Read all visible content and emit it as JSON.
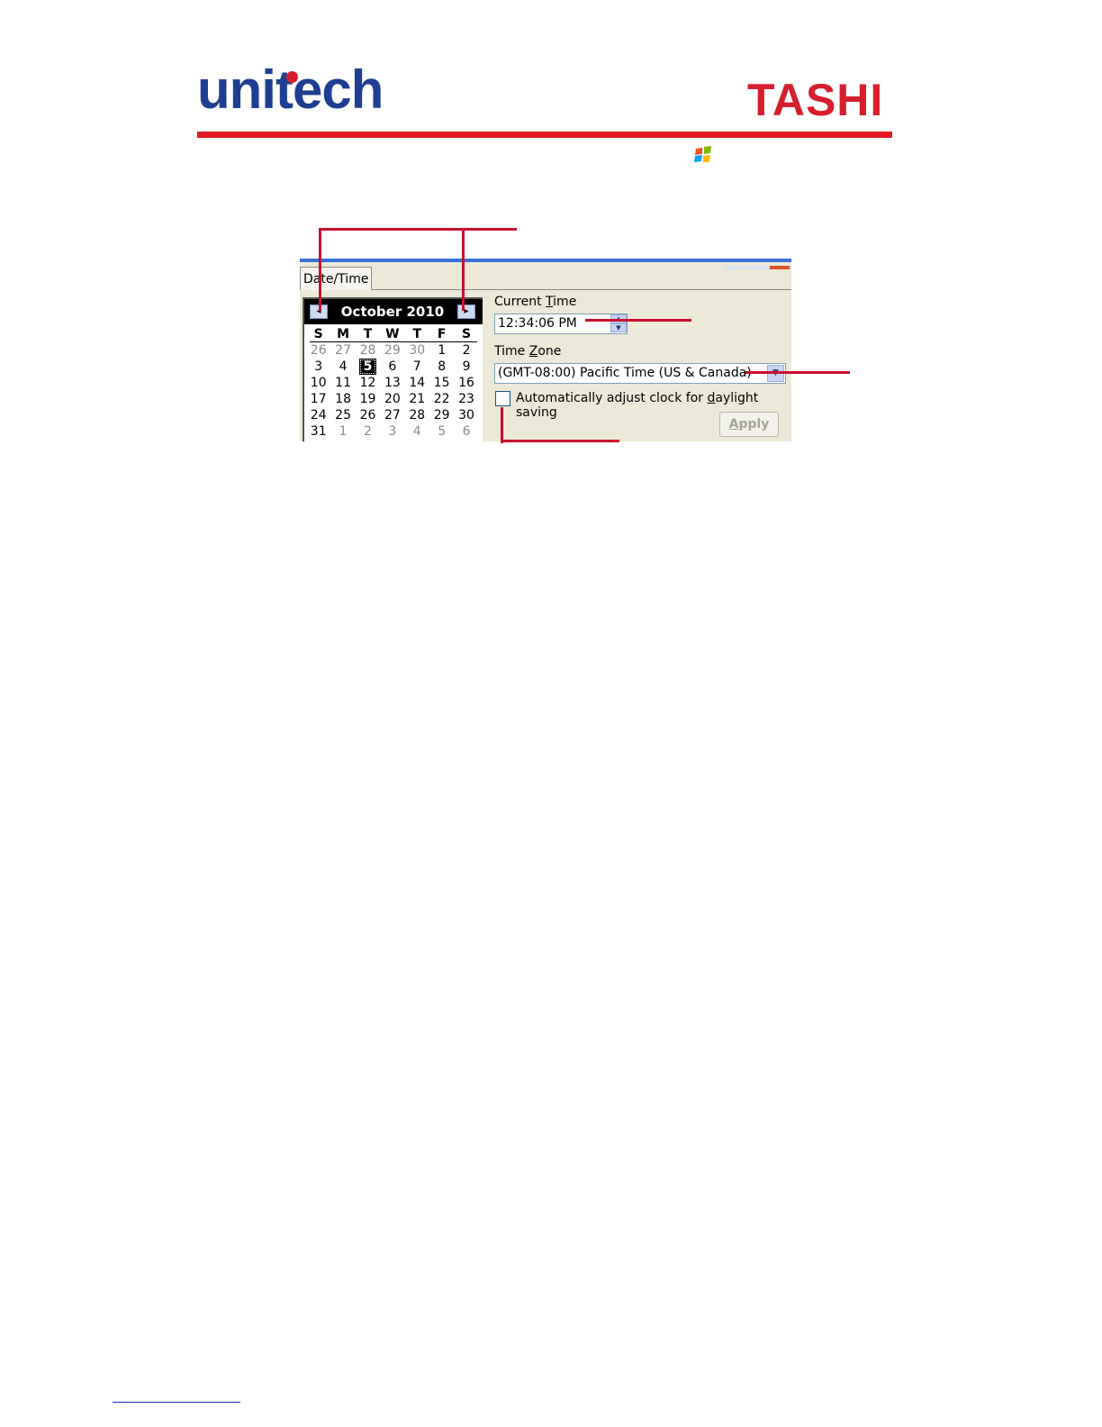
{
  "header": {
    "left_logo": "unitech",
    "right_logo": "TASHI",
    "logo_color_left": "#1e3f91",
    "logo_color_right": "#d51f2e",
    "rule_color": "#e21b23",
    "os_icon": "windows-flag-icon"
  },
  "dialog": {
    "tab_label": "Date/Time",
    "calendar": {
      "month_year": "October 2010",
      "prev_icon": "◂",
      "next_icon": "▸",
      "weekdays": [
        "S",
        "M",
        "T",
        "W",
        "T",
        "F",
        "S"
      ],
      "weeks": [
        [
          "26",
          "27",
          "28",
          "29",
          "30",
          "1",
          "2"
        ],
        [
          "3",
          "4",
          "5",
          "6",
          "7",
          "8",
          "9"
        ],
        [
          "10",
          "11",
          "12",
          "13",
          "14",
          "15",
          "16"
        ],
        [
          "17",
          "18",
          "19",
          "20",
          "21",
          "22",
          "23"
        ],
        [
          "24",
          "25",
          "26",
          "27",
          "28",
          "29",
          "30"
        ],
        [
          "31",
          "1",
          "2",
          "3",
          "4",
          "5",
          "6"
        ]
      ],
      "selected_day": "5"
    },
    "current_time_label_pre": "Current ",
    "current_time_label_key": "T",
    "current_time_label_post": "ime",
    "current_time_value": "12:34:06 PM",
    "time_zone_label_pre": "Time ",
    "time_zone_label_key": "Z",
    "time_zone_label_post": "one",
    "time_zone_value": "(GMT-08:00) Pacific Time (US & Canada)",
    "dst_label_pre": "Automatically adjust clock for ",
    "dst_label_key": "d",
    "dst_label_post": "aylight saving",
    "dst_checked": false,
    "apply_key": "A",
    "apply_rest": "pply",
    "accent_color": "#c8102e"
  }
}
